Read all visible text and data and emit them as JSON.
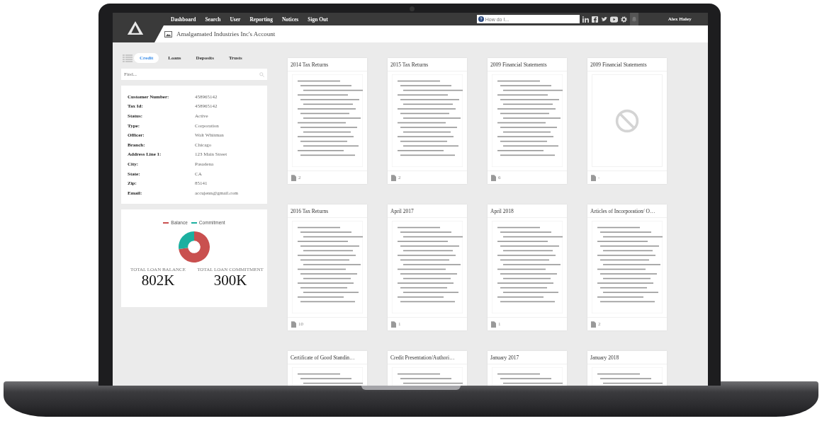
{
  "nav": {
    "items": [
      "Dashboard",
      "Search",
      "User",
      "Reporting",
      "Notices",
      "Sign Out"
    ],
    "search": {
      "placeholder": "How do I..."
    },
    "user": "Alex Haley"
  },
  "header": {
    "title": "Amalgamated Industries Inc's Account"
  },
  "tabs": [
    {
      "label": "Credit",
      "selected": true
    },
    {
      "label": "Loans",
      "selected": false
    },
    {
      "label": "Deposits",
      "selected": false
    },
    {
      "label": "Trusts",
      "selected": false
    }
  ],
  "find": {
    "placeholder": "Find..."
  },
  "details": [
    {
      "label": "Customer Number:",
      "value": "458965142"
    },
    {
      "label": "Tax Id:",
      "value": "458965142"
    },
    {
      "label": "Status:",
      "value": "Active"
    },
    {
      "label": "Type:",
      "value": "Corporation"
    },
    {
      "label": "Officer:",
      "value": "Walt Whitman"
    },
    {
      "label": "Branch:",
      "value": "Chicago"
    },
    {
      "label": "Address Line 1:",
      "value": "123 Main Street"
    },
    {
      "label": "City:",
      "value": "Pasadena"
    },
    {
      "label": "State:",
      "value": "CA"
    },
    {
      "label": "Zip:",
      "value": "85141"
    },
    {
      "label": "Email:",
      "value": "accujenn@gmail.com"
    }
  ],
  "loans": {
    "chart_data": {
      "type": "donut",
      "categories": [
        "Balance",
        "Commitment"
      ],
      "values": [
        72.8,
        27.2
      ]
    },
    "legend": [
      {
        "color": "#c9504f"
      },
      {
        "color": "#1cb0a0"
      }
    ],
    "totals": [
      {
        "label": "TOTAL LOAN BALANCE",
        "value": "802K"
      },
      {
        "label": "TOTAL LOAN COMMITMENT",
        "value": "300K"
      }
    ]
  },
  "documents": [
    {
      "title": "2014 Tax Returns",
      "kind": "document",
      "count": "2"
    },
    {
      "title": "2015 Tax Returns",
      "kind": "document",
      "count": "2"
    },
    {
      "title": "2009 Financial Statements",
      "kind": "document",
      "count": "6"
    },
    {
      "title": "2009 Financial Statements",
      "kind": "unavailable",
      "count": "-"
    },
    {
      "title": "2016 Tax Returns",
      "kind": "document",
      "count": "10"
    },
    {
      "title": "April 2017",
      "kind": "document",
      "count": "1"
    },
    {
      "title": "April 2018",
      "kind": "document",
      "count": "1"
    },
    {
      "title": "Articles of Incorporation/ O…",
      "kind": "document",
      "count": "2"
    },
    {
      "title": "Certificate of Good Standin…",
      "kind": "document"
    },
    {
      "title": "Credit Presentation/Authori…",
      "kind": "document"
    },
    {
      "title": "January 2017",
      "kind": "document"
    },
    {
      "title": "January 2018",
      "kind": "document"
    }
  ]
}
